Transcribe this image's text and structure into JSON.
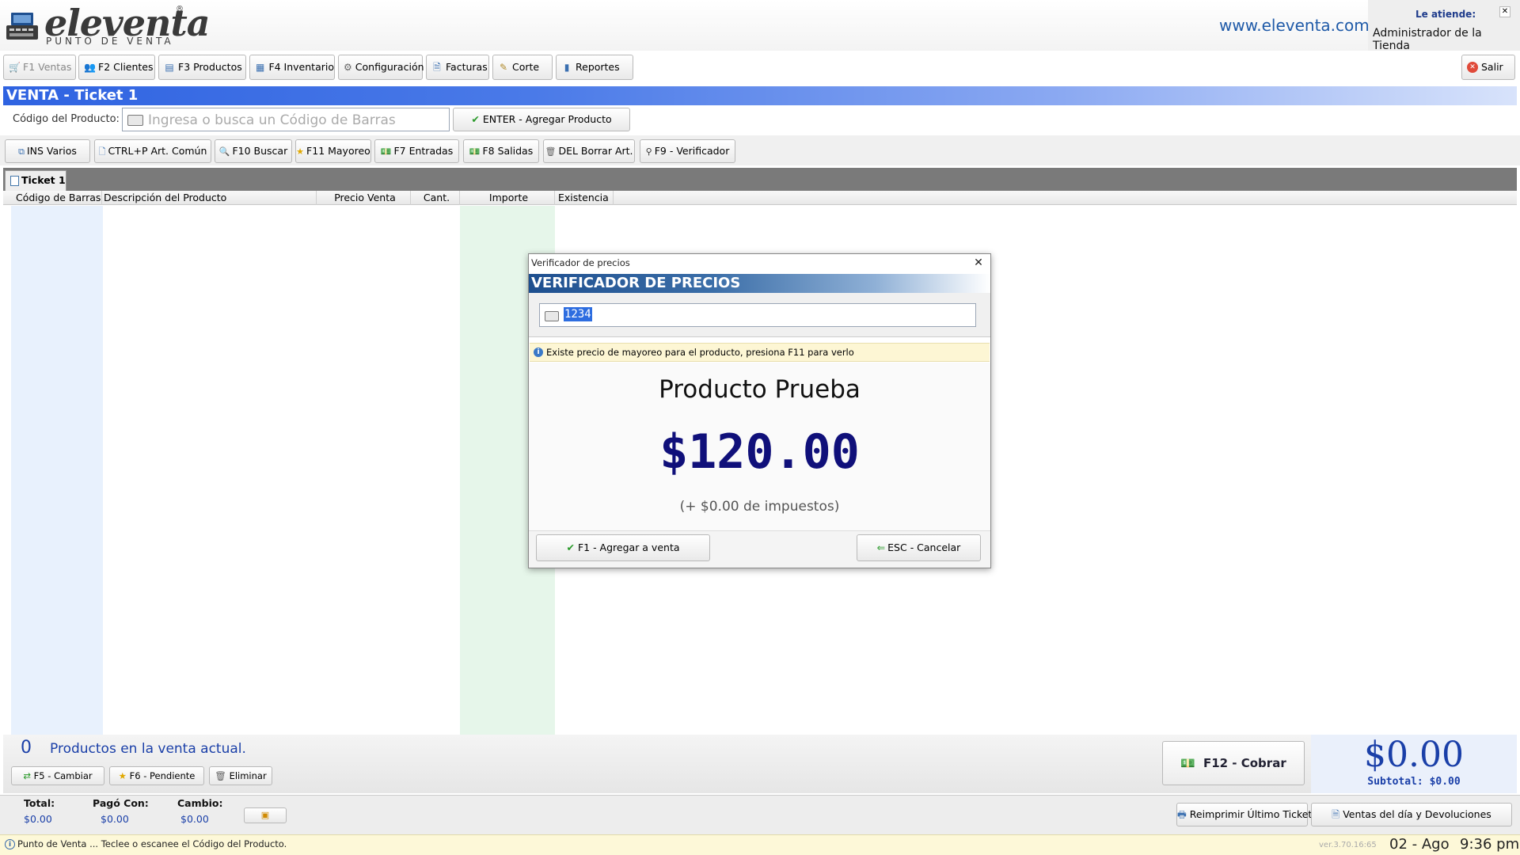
{
  "header": {
    "logo_text": "eleventa",
    "logo_reg": "®",
    "logo_subtitle": "PUNTO DE VENTA",
    "site_url": "www.eleventa.com",
    "attends_label": "Le atiende:",
    "attends_user": "Administrador de la Tienda"
  },
  "toolbar": {
    "ventas": "F1 Ventas",
    "clientes": "F2 Clientes",
    "productos": "F3 Productos",
    "inventario": "F4 Inventario",
    "configuracion": "Configuración",
    "facturas": "Facturas",
    "corte": "Corte",
    "reportes": "Reportes",
    "salir": "Salir"
  },
  "venta": {
    "title": "VENTA - Ticket 1",
    "code_label": "Código del Producto:",
    "code_placeholder": "Ingresa o busca un Código de Barras",
    "enter_button": "ENTER - Agregar Producto"
  },
  "functions": {
    "ins_varios": "INS Varios",
    "art_comun": "CTRL+P Art. Común",
    "buscar": "F10 Buscar",
    "mayoreo": "F11 Mayoreo",
    "entradas": "F7 Entradas",
    "salidas": "F8 Salidas",
    "borrar": "DEL Borrar Art.",
    "verificador": "F9 - Verificador"
  },
  "tabs": [
    {
      "label": "Ticket 1"
    }
  ],
  "table": {
    "columns": [
      "Código de Barras",
      "Descripción del Producto",
      "Precio Venta",
      "Cant.",
      "Importe",
      "Existencia"
    ],
    "rows": []
  },
  "summary": {
    "count": "0",
    "count_label": "Productos en la venta actual.",
    "cambiar": "F5 - Cambiar",
    "pendiente": "F6 - Pendiente",
    "eliminar": "Eliminar",
    "cobrar": "F12 - Cobrar",
    "total_amount": "$0.00",
    "subtotal": "Subtotal: $0.00"
  },
  "totals": {
    "total_label": "Total:",
    "total_value": "$0.00",
    "pago_label": "Pagó Con:",
    "pago_value": "$0.00",
    "cambio_label": "Cambio:",
    "cambio_value": "$0.00",
    "reprint": "Reimprimir Último Ticket",
    "ventas_dia": "Ventas del día y Devoluciones"
  },
  "status": {
    "message": "Punto de Venta ... Teclee o escanee el Código del Producto.",
    "version": "ver.3.70.16:65",
    "date": "02 - Ago",
    "time": "9:36 pm"
  },
  "dialog": {
    "window_title": "Verificador de precios",
    "banner": "VERIFICADOR DE PRECIOS",
    "input_value": "1234",
    "info": "Existe precio de mayoreo para el producto, presiona F11 para verlo",
    "product_name": "Producto Prueba",
    "price": "$120.00",
    "tax": "(+ $0.00 de impuestos)",
    "add_button": "F1 - Agregar a venta",
    "cancel_button": "ESC - Cancelar"
  },
  "colors": {
    "accent_blue": "#2f63e1",
    "price_navy": "#10107a",
    "link_blue": "#1f5aa8"
  }
}
